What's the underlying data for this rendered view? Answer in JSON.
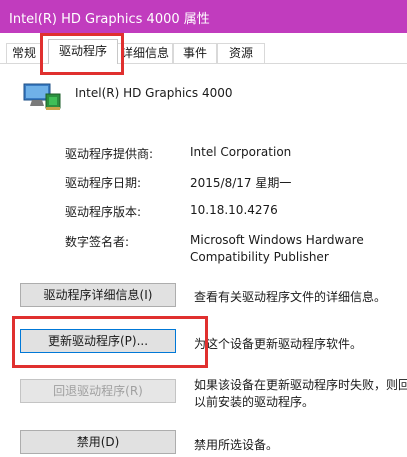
{
  "window": {
    "title": "Intel(R) HD Graphics 4000 属性",
    "title_bar_color": "#c13cbe"
  },
  "tabs": [
    {
      "label": "常规"
    },
    {
      "label": "驱动程序",
      "active": true
    },
    {
      "label": "详细信息"
    },
    {
      "label": "事件"
    },
    {
      "label": "资源"
    }
  ],
  "device": {
    "name": "Intel(R) HD Graphics 4000",
    "icon": "display-adapter-icon"
  },
  "properties": [
    {
      "label": "驱动程序提供商:",
      "value": "Intel Corporation"
    },
    {
      "label": "驱动程序日期:",
      "value": "2015/8/17 星期一"
    },
    {
      "label": "驱动程序版本:",
      "value": "10.18.10.4276"
    },
    {
      "label": "数字签名者:",
      "value": "Microsoft Windows Hardware",
      "value_line2": "Compatibility Publisher"
    }
  ],
  "actions": [
    {
      "button": "驱动程序详细信息(I)",
      "description": "查看有关驱动程序文件的详细信息。"
    },
    {
      "button": "更新驱动程序(P)...",
      "description": "为这个设备更新驱动程序软件。"
    },
    {
      "button": "回退驱动程序(R)",
      "description": "如果该设备在更新驱动程序时失败，则回",
      "description_line2": "以前安装的驱动程序。",
      "disabled": true
    },
    {
      "button": "禁用(D)",
      "description": "禁用所选设备。"
    }
  ],
  "colors": {
    "highlight": "#e0302f",
    "focus_border": "#0078d7"
  }
}
